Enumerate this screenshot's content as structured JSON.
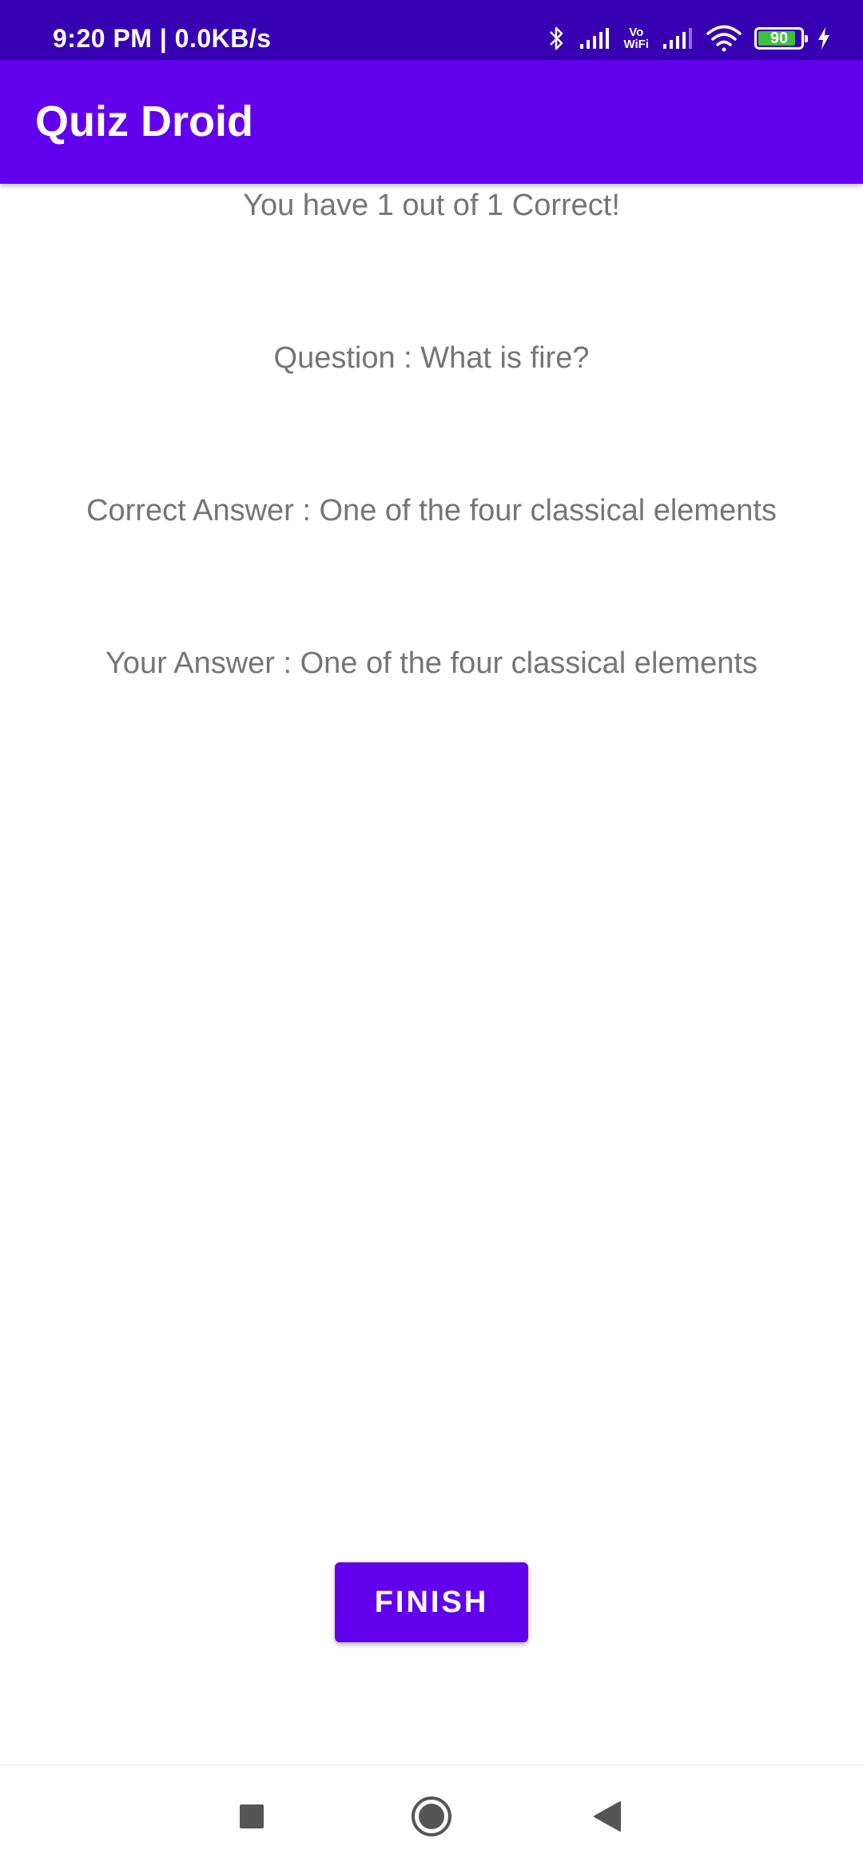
{
  "status_bar": {
    "time": "9:20 PM | 0.0KB/s",
    "battery_level": "90",
    "battery_fraction": 0.9,
    "icons": [
      "bluetooth-icon",
      "signal-icon",
      "vowifi-icon",
      "signal-icon",
      "wifi-icon",
      "battery-icon",
      "charging-icon"
    ],
    "vowifi_label_top": "Vo",
    "vowifi_label_bottom": "WiFi",
    "background_color": "#3700b3"
  },
  "app_bar": {
    "title": "Quiz Droid",
    "color": "#6200ee"
  },
  "results": {
    "score": "You have 1 out of 1 Correct!",
    "question": "Question : What is fire?",
    "correct_answer": "Correct Answer : One of the four classical elements",
    "your_answer": "Your Answer : One of the four classical elements"
  },
  "actions": {
    "finish_label": "FINISH"
  },
  "nav_bar": {
    "icons": [
      "recents-square-icon",
      "home-circle-icon",
      "back-triangle-icon"
    ]
  }
}
